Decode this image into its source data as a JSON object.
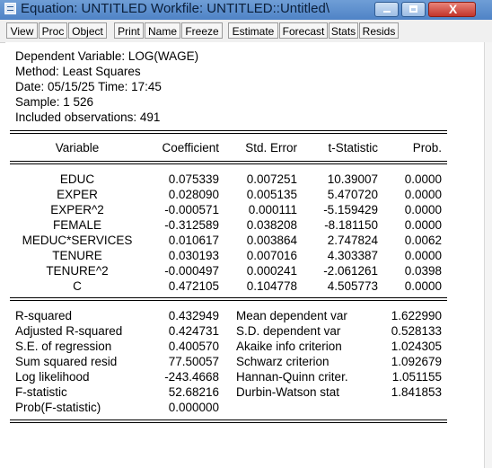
{
  "window": {
    "title": "Equation: UNTITLED   Workfile: UNTITLED::Untitled\\",
    "close_glyph": "X"
  },
  "toolbar": {
    "buttons": [
      "View",
      "Proc",
      "Object",
      "Print",
      "Name",
      "Freeze",
      "Estimate",
      "Forecast",
      "Stats",
      "Resids"
    ]
  },
  "header": {
    "dependent": "Dependent Variable: LOG(WAGE)",
    "method": "Method: Least Squares",
    "date": "Date: 05/15/25   Time: 17:45",
    "sample": "Sample: 1 526",
    "obs": "Included observations: 491"
  },
  "columns": [
    "Variable",
    "Coefficient",
    "Std. Error",
    "t-Statistic",
    "Prob."
  ],
  "rows": [
    [
      "EDUC",
      "0.075339",
      "0.007251",
      "10.39007",
      "0.0000"
    ],
    [
      "EXPER",
      "0.028090",
      "0.005135",
      "5.470720",
      "0.0000"
    ],
    [
      "EXPER^2",
      "-0.000571",
      "0.000111",
      "-5.159429",
      "0.0000"
    ],
    [
      "FEMALE",
      "-0.312589",
      "0.038208",
      "-8.181150",
      "0.0000"
    ],
    [
      "MEDUC*SERVICES",
      "0.010617",
      "0.003864",
      "2.747824",
      "0.0062"
    ],
    [
      "TENURE",
      "0.030193",
      "0.007016",
      "4.303387",
      "0.0000"
    ],
    [
      "TENURE^2",
      "-0.000497",
      "0.000241",
      "-2.061261",
      "0.0398"
    ],
    [
      "C",
      "0.472105",
      "0.104778",
      "4.505773",
      "0.0000"
    ]
  ],
  "stats_left": [
    [
      "R-squared",
      "0.432949"
    ],
    [
      "Adjusted R-squared",
      "0.424731"
    ],
    [
      "S.E. of regression",
      "0.400570"
    ],
    [
      "Sum squared resid",
      "77.50057"
    ],
    [
      "Log likelihood",
      "-243.4668"
    ],
    [
      "F-statistic",
      "52.68216"
    ],
    [
      "Prob(F-statistic)",
      "0.000000"
    ]
  ],
  "stats_right": [
    [
      "Mean dependent var",
      "1.622990"
    ],
    [
      "S.D. dependent var",
      "0.528133"
    ],
    [
      "Akaike info criterion",
      "1.024305"
    ],
    [
      "Schwarz criterion",
      "1.092679"
    ],
    [
      "Hannan-Quinn criter.",
      "1.051155"
    ],
    [
      "Durbin-Watson stat",
      "1.841853"
    ]
  ]
}
